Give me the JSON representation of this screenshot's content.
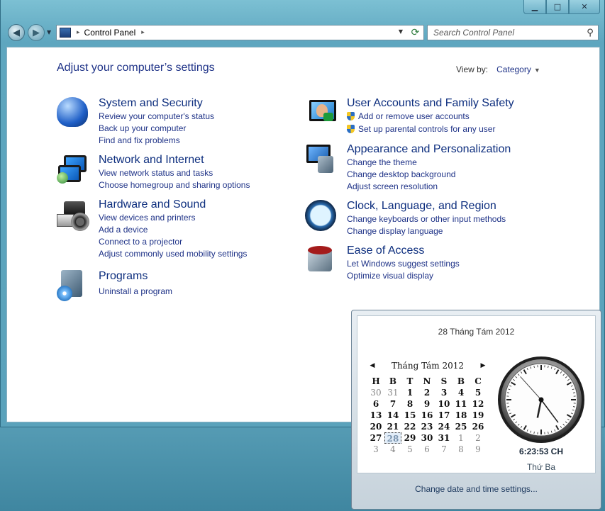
{
  "window": {
    "caption": {
      "minimize_icon": "minimize-icon",
      "maximize_icon": "maximize-icon",
      "close_icon": "close-icon"
    }
  },
  "navbar": {
    "breadcrumb": "Control Panel",
    "search_placeholder": "Search Control Panel"
  },
  "header": {
    "title": "Adjust your computer’s settings",
    "view_by_label": "View by:",
    "view_by_value": "Category"
  },
  "categories": [
    {
      "title": "System and Security",
      "links": [
        "Review your computer's status",
        "Back up your computer",
        "Find and fix problems"
      ]
    },
    {
      "title": "Network and Internet",
      "links": [
        "View network status and tasks",
        "Choose homegroup and sharing options"
      ]
    },
    {
      "title": "Hardware and Sound",
      "links": [
        "View devices and printers",
        "Add a device",
        "Connect to a projector",
        "Adjust commonly used mobility settings"
      ]
    },
    {
      "title": "Programs",
      "links": [
        "Uninstall a program"
      ]
    },
    {
      "title": "User Accounts and Family Safety",
      "links": [
        "Add or remove user accounts",
        "Set up parental controls for any user"
      ]
    },
    {
      "title": "Appearance and Personalization",
      "links": [
        "Change the theme",
        "Change desktop background",
        "Adjust screen resolution"
      ]
    },
    {
      "title": "Clock, Language, and Region",
      "links": [
        "Change keyboards or other input methods",
        "Change display language"
      ]
    },
    {
      "title": "Ease of Access",
      "links": [
        "Let Windows suggest settings",
        "Optimize visual display"
      ]
    }
  ],
  "clock_popup": {
    "date_long": "28 Tháng Tám 2012",
    "month_label": "Tháng Tám 2012",
    "weekdays": [
      "H",
      "B",
      "T",
      "N",
      "S",
      "B",
      "C"
    ],
    "weeks": [
      [
        "30",
        "31",
        "1",
        "2",
        "3",
        "4",
        "5"
      ],
      [
        "6",
        "7",
        "8",
        "9",
        "10",
        "11",
        "12"
      ],
      [
        "13",
        "14",
        "15",
        "16",
        "17",
        "18",
        "19"
      ],
      [
        "20",
        "21",
        "22",
        "23",
        "24",
        "25",
        "26"
      ],
      [
        "27",
        "28",
        "29",
        "30",
        "31",
        "1",
        "2"
      ],
      [
        "3",
        "4",
        "5",
        "6",
        "7",
        "8",
        "9"
      ]
    ],
    "today": "28",
    "time": "6:23:53 CH",
    "weekday_name": "Thứ Ba",
    "settings_link": "Change date and time settings..."
  }
}
